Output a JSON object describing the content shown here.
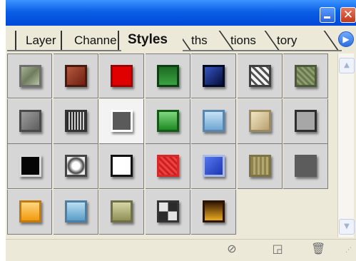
{
  "window": {
    "minimize_label": "",
    "close_label": "✕"
  },
  "tabs": [
    {
      "label": "Layer",
      "active": false
    },
    {
      "label": "Channe",
      "active": false
    },
    {
      "label": "Styles",
      "active": true
    },
    {
      "label": "ths",
      "active": false
    },
    {
      "label": "tions",
      "active": false
    },
    {
      "label": "tory",
      "active": false
    }
  ],
  "menu_arrow_label": "▶",
  "styles": [
    {
      "name": "style-1",
      "bg": "linear-gradient(135deg,#a8b294,#6f7c5e,#b9c1a3)",
      "border": "#6f6f6f"
    },
    {
      "name": "style-2",
      "bg": "linear-gradient(135deg,#b3583d,#6e1f12)",
      "border": "#4a1a10"
    },
    {
      "name": "style-3",
      "bg": "#e00000",
      "border": "#a00000"
    },
    {
      "name": "style-4",
      "bg": "linear-gradient(180deg,#1c6b23,#3aa341)",
      "border": "#0d3f12"
    },
    {
      "name": "style-5",
      "bg": "linear-gradient(135deg,#3555c2,#050d3a)",
      "border": "#020a24"
    },
    {
      "name": "style-6",
      "bg": "repeating-linear-gradient(45deg,#f4f4f4 0 4px,#525252 4px 7px)",
      "border": "#3f3f3f"
    },
    {
      "name": "style-7",
      "bg": "repeating-linear-gradient(45deg,#6a7a4f 0 3px,#8f9f70 3px 6px)",
      "border": "#4d5a38"
    },
    {
      "name": "style-8",
      "bg": "linear-gradient(135deg,#9d9d9d,#5e5e5e)",
      "border": "#4a4a4a"
    },
    {
      "name": "style-9",
      "bg": "repeating-linear-gradient(90deg,#2a2a2a 0 2px,#cfcfcf 2px 4px)",
      "border": "#333333"
    },
    {
      "name": "style-10",
      "bg": "#5a5a5a",
      "border": "#ffffff"
    },
    {
      "name": "style-11",
      "bg": "linear-gradient(180deg,#7fd87f,#1e8a22)",
      "border": "#145a16"
    },
    {
      "name": "style-12",
      "bg": "linear-gradient(180deg,#c5e2f6,#6fa6d2)",
      "border": "#5a86ad"
    },
    {
      "name": "style-13",
      "bg": "linear-gradient(135deg,#f1e6c4,#b9a170)",
      "border": "#9c8a60"
    },
    {
      "name": "style-14",
      "bg": "#a7a7a7",
      "border": "#2e2e2e"
    },
    {
      "name": "style-15",
      "bg": "#050505",
      "border": "#d8d8d8"
    },
    {
      "name": "style-16",
      "bg": "radial-gradient(circle,#ffffff 30%,#444 60%,#eeeeee 75%)",
      "border": "#454545"
    },
    {
      "name": "style-17",
      "bg": "#ffffff",
      "border": "#111111"
    },
    {
      "name": "style-18",
      "bg": "repeating-linear-gradient(45deg,#ee4040 0 3px,#c81f1f 3px 6px)",
      "border": "#d42a2a"
    },
    {
      "name": "style-19",
      "bg": "linear-gradient(135deg,#5577ee,#1c36b4)",
      "border": "#a9b9e8"
    },
    {
      "name": "style-20",
      "bg": "repeating-linear-gradient(90deg,#8f8450 0 3px,#b4a96d 3px 6px)",
      "border": "#7d7344"
    },
    {
      "name": "style-21",
      "bg": "#5c5c5c",
      "border": "#5c5c5c"
    },
    {
      "name": "style-22",
      "bg": "linear-gradient(180deg,#ffd680,#f19a0d)",
      "border": "#c07a10"
    },
    {
      "name": "style-23",
      "bg": "linear-gradient(180deg,#b9def0,#5b9dc9)",
      "border": "#4d7fa6"
    },
    {
      "name": "style-24",
      "bg": "linear-gradient(180deg,#d6d6a6,#8f8f57)",
      "border": "#6f6f45"
    },
    {
      "name": "style-25",
      "bg": "repeating-conic-gradient(#2a2a2a 0 25%,#e4e4e4 0 50%)",
      "border": "#333333"
    },
    {
      "name": "style-26",
      "bg": "linear-gradient(180deg,#3a1c05,#ebaa1f)",
      "border": "#2b1402"
    }
  ],
  "bottom": {
    "no_style_icon": "⊘",
    "new_style_icon": "◲",
    "delete_icon": "🗑",
    "grip": "⋰"
  }
}
